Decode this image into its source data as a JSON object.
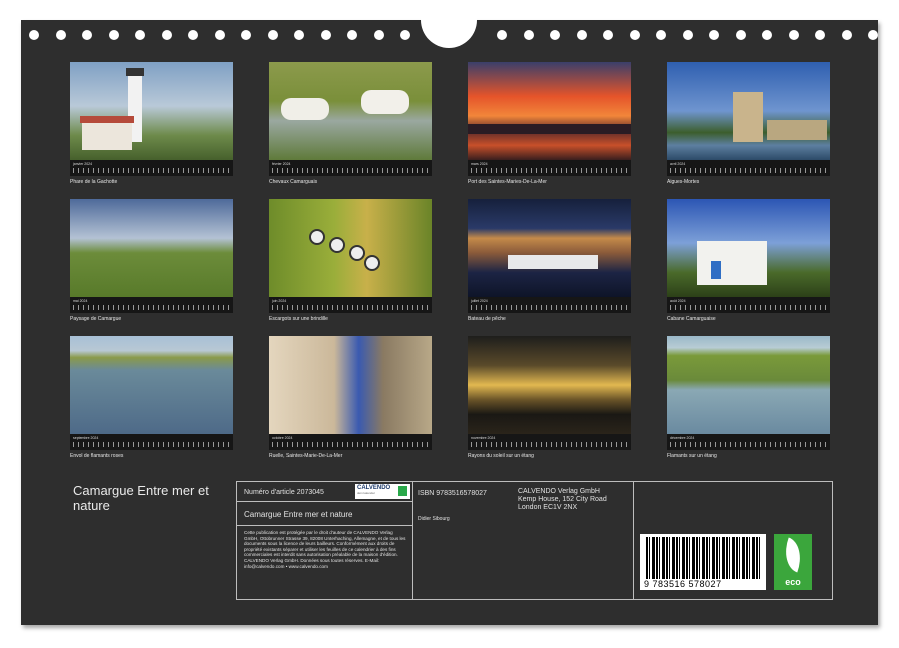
{
  "calendar": {
    "title": "Camargue Entre mer et nature",
    "months": [
      {
        "month": "janvier 2024",
        "caption": "Phare de la Gachotte"
      },
      {
        "month": "février 2024",
        "caption": "Chevaux Camarguais"
      },
      {
        "month": "mars 2024",
        "caption": "Port des Saintes-Maries-De-La-Mer"
      },
      {
        "month": "avril 2024",
        "caption": "Aigues-Mortes"
      },
      {
        "month": "mai 2024",
        "caption": "Paysage de Camargue"
      },
      {
        "month": "juin 2024",
        "caption": "Escargots sur une brindille"
      },
      {
        "month": "juillet 2024",
        "caption": "Bateau de pêche"
      },
      {
        "month": "août 2024",
        "caption": "Cabane Camarguaise"
      },
      {
        "month": "septembre 2024",
        "caption": "Envol de flamants roses"
      },
      {
        "month": "octobre 2024",
        "caption": "Ruelle, Saintes-Marie-De-La-Mer"
      },
      {
        "month": "novembre 2024",
        "caption": "Rayons du soleil sur un étang"
      },
      {
        "month": "décembre 2024",
        "caption": "Flamants sur un étang"
      }
    ]
  },
  "info": {
    "article": "Numéro d'article 2073045",
    "logo": "CALVENDO",
    "logo_sub": "dein kalender",
    "product_title": "Camargue Entre mer et nature",
    "isbn": "ISBN 9783516578027",
    "publisher": [
      "CALVENDO Verlag GmbH",
      "Kemp House, 152 City Road",
      "London EC1V 2NX"
    ],
    "author": "Didier Sibourg",
    "legal": "Cette publication est protégée par le droit d'auteur de CALVENDO Verlag GmbH, Ottobrunner Strasse 39, 82008 Unterhaching, Allemagne, et de tous les documents sous la licence de leurs bailleurs. Conformément aux droits de propriété existants séparer et utiliser les feuilles de ce calendrier à des fins commerciales est interdit sans autorisation préalable de la maison d'édition. CALVENDO Verlag GmbH. Données sous toutes réserves. E-Mail: info@calvendo.com • www.calvendo.com",
    "barcode_number": "9 783516 578027",
    "eco_label": "eco"
  },
  "colors": {
    "board": "#2e2e2e",
    "eco": "#3ba63c"
  }
}
